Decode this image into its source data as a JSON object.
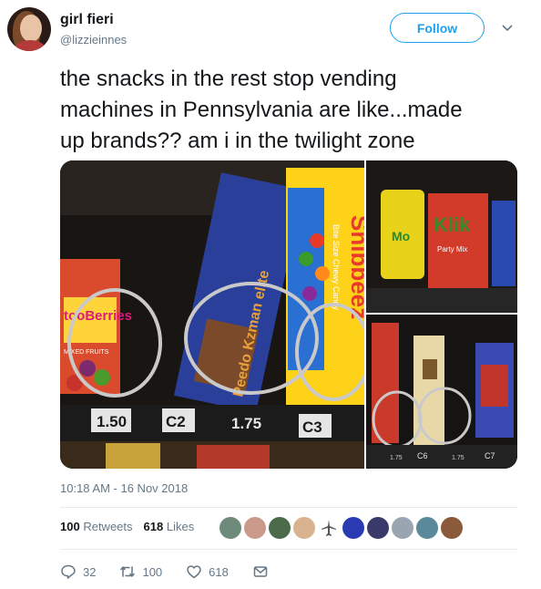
{
  "user": {
    "display_name": "girl fieri",
    "handle": "@lizzieinnes"
  },
  "follow_label": "Follow",
  "tweet": {
    "line1": "the snacks in the rest stop vending",
    "line2": "machines in Pennsylvania are like...made",
    "line3": "up brands?? am i in the twilight zone"
  },
  "media": {
    "price1": "1.50",
    "slot_c2": "C2",
    "price2": "1.75",
    "slot_c3": "C3",
    "brand_snibbeez": "Snibbeez",
    "brand_snibbeez_sub": "Bite Size Chewy Candy",
    "brand_peanut": "Peedo Kzman elite",
    "brand_tooberries": "tooBerries",
    "brand_mixed": "MIXED FRUITS",
    "brand_klik": "Klik",
    "brand_klik_sub": "Party Mix",
    "brand_mo": "Mo",
    "price_br1": "1.75",
    "price_br2": "1.75",
    "slot_c6": "C6",
    "slot_c7": "C7"
  },
  "timestamp": "10:18 AM - 16 Nov 2018",
  "stats": {
    "retweets_count": "100",
    "retweets_label": "Retweets",
    "likes_count": "618",
    "likes_label": "Likes"
  },
  "actions": {
    "reply_count": "32",
    "retweet_count": "100",
    "like_count": "618"
  },
  "colors": {
    "accent": "#1da1f2",
    "secondary_text": "#657786"
  }
}
